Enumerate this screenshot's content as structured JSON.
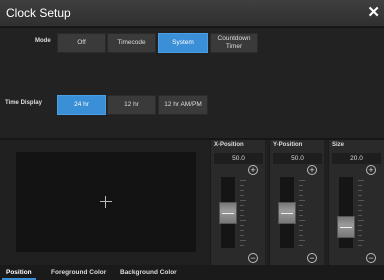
{
  "header": {
    "title": "Clock Setup",
    "close": "✕"
  },
  "mode": {
    "label": "Mode",
    "options": [
      "Off",
      "Timecode",
      "System",
      "Countdown Timer"
    ],
    "selected": "System"
  },
  "time_display": {
    "label": "Time Display",
    "options": [
      "24 hr",
      "12 hr",
      "12 hr AM/PM"
    ],
    "selected": "24 hr"
  },
  "sliders": [
    {
      "title": "X-Position",
      "value": "50.0",
      "level": 0.5
    },
    {
      "title": "Y-Position",
      "value": "50.0",
      "level": 0.5
    },
    {
      "title": "Size",
      "value": "20.0",
      "level": 0.2
    }
  ],
  "tabs": [
    "Position",
    "Foreground Color",
    "Background Color"
  ],
  "active_tab": "Position",
  "colors": {
    "accent": "#3b8fd6"
  }
}
